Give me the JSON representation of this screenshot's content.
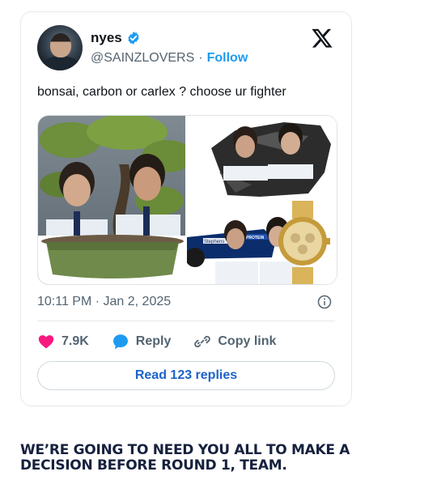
{
  "tweet": {
    "display_name": "nyes",
    "handle": "@SAINZLOVERS",
    "separator": "·",
    "follow_label": "Follow",
    "text": "bonsai, carbon or carlex ? choose ur fighter",
    "timestamp": "10:11 PM · Jan 2, 2025",
    "likes": "7.9K",
    "reply_label": "Reply",
    "copy_link_label": "Copy link",
    "read_replies_label": "Read 123 replies",
    "media": {
      "car_livery_left": "Stephens",
      "car_livery_right": "PROTEIN"
    }
  },
  "caption": "WE’RE GOING TO NEED YOU ALL TO MAKE A DECISION BEFORE ROUND 1, TEAM.",
  "colors": {
    "accent_blue": "#1d9bf0",
    "like_pink": "#f91880",
    "caption_navy": "#16213e"
  },
  "icons": [
    "verified-icon",
    "x-logo-icon",
    "info-icon",
    "heart-icon",
    "reply-bubble-icon",
    "link-icon"
  ]
}
